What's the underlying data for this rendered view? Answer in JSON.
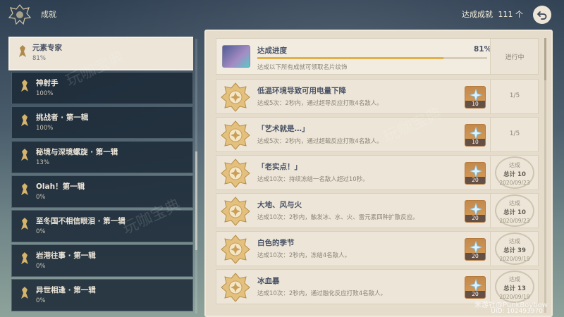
{
  "header": {
    "title": "成就",
    "total_label": "达成成就",
    "total_count": "111",
    "total_unit": "个",
    "back_icon": "back-arrow-icon"
  },
  "sidebar": {
    "items": [
      {
        "name": "元素专家",
        "percent": "81%",
        "active": true
      },
      {
        "name": "神射手",
        "percent": "100%"
      },
      {
        "name": "挑战者 · 第一辑",
        "percent": "100%"
      },
      {
        "name": "秘境与深境螺旋 · 第一辑",
        "percent": "13%"
      },
      {
        "name": "Olah！第一辑",
        "percent": "0%"
      },
      {
        "name": "至冬国不相信眼泪 · 第一辑",
        "percent": "0%"
      },
      {
        "name": "岩港往事 · 第一辑",
        "percent": "0%"
      },
      {
        "name": "异世相逢 · 第一辑",
        "percent": "0%"
      }
    ]
  },
  "summary": {
    "title": "达成进度",
    "percent": "81%",
    "progress": 0.81,
    "description": "达成以下所有成就可领取名片纹饰",
    "state": "进行中"
  },
  "achievements": [
    {
      "name": "低温环境导致可用电量下降",
      "desc": "达成5次：2秒内，通过超导反应打败4名敌人。",
      "reward": "10",
      "progress": "1/5"
    },
    {
      "name": "「艺术就是…」",
      "desc": "达成5次：2秒内，通过超载反应打败4名敌人。",
      "reward": "10",
      "progress": "1/5"
    },
    {
      "name": "「老实点！」",
      "desc": "达成10次：持续冻结一名敌人超过10秒。",
      "reward": "20",
      "stamp_label": "达成",
      "stamp_total": "总计 10",
      "date": "2020/09/23"
    },
    {
      "name": "大地、风与火",
      "desc": "达成10次：2秒内，触发冰、水、火、雷元素四种扩散反应。",
      "reward": "20",
      "stamp_label": "达成",
      "stamp_total": "总计 10",
      "date": "2020/09/23"
    },
    {
      "name": "白色的季节",
      "desc": "达成10次：2秒内，冻结4名敌人。",
      "reward": "20",
      "stamp_label": "达成",
      "stamp_total": "总计 39",
      "date": "2020/09/19"
    },
    {
      "name": "冰血暴",
      "desc": "达成10次：2秒内，通过融化反应打败4名敌人。",
      "reward": "20",
      "stamp_label": "达成",
      "stamp_total": "总计 13",
      "date": "2020/09/19"
    }
  ],
  "footer": {
    "uid": "UID: 102493970",
    "watermark_text": "玩咖宝典",
    "credit": "米游社@PunkBoybow"
  }
}
